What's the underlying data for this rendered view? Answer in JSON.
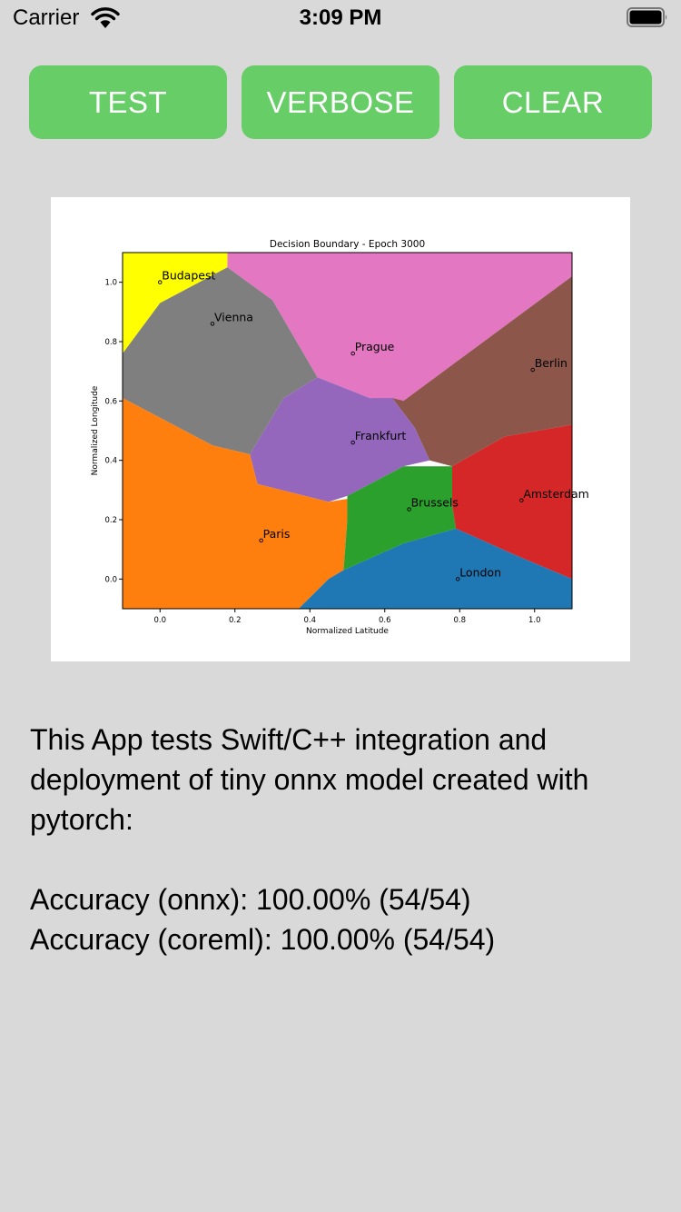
{
  "status_bar": {
    "carrier": "Carrier",
    "time": "3:09 PM",
    "wifi_icon": "wifi-icon",
    "battery_icon": "battery-icon"
  },
  "buttons": {
    "test": "TEST",
    "verbose": "VERBOSE",
    "clear": "CLEAR",
    "color": "#66cd67"
  },
  "chart_data": {
    "type": "scatter",
    "title": "Decision Boundary - Epoch 3000",
    "xlabel": "Normalized Latitude",
    "ylabel": "Normalized Longitude",
    "xlim": [
      -0.1,
      1.1
    ],
    "ylim": [
      -0.1,
      1.1
    ],
    "xticks": [
      0.0,
      0.2,
      0.4,
      0.6,
      0.8,
      1.0
    ],
    "yticks": [
      0.0,
      0.2,
      0.4,
      0.6,
      0.8,
      1.0
    ],
    "tick_labels_x": [
      "0.0",
      "0.2",
      "0.4",
      "0.6",
      "0.8",
      "1.0"
    ],
    "tick_labels_y": [
      "0.0",
      "0.2",
      "0.4",
      "0.6",
      "0.8",
      "1.0"
    ],
    "points": [
      {
        "label": "Budapest",
        "x": 0.0,
        "y": 1.0,
        "color": "#ffff00"
      },
      {
        "label": "Vienna",
        "x": 0.14,
        "y": 0.86,
        "color": "#7f7f7f"
      },
      {
        "label": "Prague",
        "x": 0.515,
        "y": 0.76,
        "color": "#e377c2"
      },
      {
        "label": "Berlin",
        "x": 0.995,
        "y": 0.705,
        "color": "#8c564b"
      },
      {
        "label": "Frankfurt",
        "x": 0.515,
        "y": 0.46,
        "color": "#9467bd"
      },
      {
        "label": "Brussels",
        "x": 0.665,
        "y": 0.235,
        "color": "#2ca02c"
      },
      {
        "label": "Amsterdam",
        "x": 0.965,
        "y": 0.265,
        "color": "#d62728"
      },
      {
        "label": "Paris",
        "x": 0.27,
        "y": 0.13,
        "color": "#ff7f0e"
      },
      {
        "label": "London",
        "x": 0.795,
        "y": 0.0,
        "color": "#1f77b4"
      }
    ],
    "regions": [
      {
        "label": "Budapest",
        "color": "#ffff00",
        "polygon": [
          [
            -0.1,
            1.1
          ],
          [
            0.18,
            1.1
          ],
          [
            0.18,
            1.05
          ],
          [
            0.0,
            0.93
          ],
          [
            -0.1,
            0.76
          ]
        ]
      },
      {
        "label": "Prague",
        "color": "#e377c2",
        "polygon": [
          [
            0.18,
            1.1
          ],
          [
            1.1,
            1.1
          ],
          [
            1.1,
            1.02
          ],
          [
            0.65,
            0.6
          ],
          [
            0.56,
            0.61
          ],
          [
            0.42,
            0.68
          ],
          [
            0.3,
            0.94
          ],
          [
            0.18,
            1.05
          ]
        ]
      },
      {
        "label": "Vienna",
        "color": "#7f7f7f",
        "polygon": [
          [
            0.0,
            0.93
          ],
          [
            0.18,
            1.05
          ],
          [
            0.3,
            0.94
          ],
          [
            0.42,
            0.68
          ],
          [
            0.33,
            0.61
          ],
          [
            0.24,
            0.42
          ],
          [
            0.14,
            0.45
          ],
          [
            -0.1,
            0.61
          ],
          [
            -0.1,
            0.76
          ]
        ]
      },
      {
        "label": "Berlin",
        "color": "#8c564b",
        "polygon": [
          [
            0.65,
            0.6
          ],
          [
            1.1,
            1.02
          ],
          [
            1.1,
            0.52
          ],
          [
            0.92,
            0.48
          ],
          [
            0.78,
            0.38
          ],
          [
            0.72,
            0.4
          ],
          [
            0.68,
            0.51
          ],
          [
            0.62,
            0.61
          ]
        ]
      },
      {
        "label": "Frankfurt",
        "color": "#9467bd",
        "polygon": [
          [
            0.42,
            0.68
          ],
          [
            0.56,
            0.61
          ],
          [
            0.62,
            0.61
          ],
          [
            0.68,
            0.51
          ],
          [
            0.72,
            0.4
          ],
          [
            0.65,
            0.38
          ],
          [
            0.5,
            0.28
          ],
          [
            0.45,
            0.26
          ],
          [
            0.26,
            0.32
          ],
          [
            0.24,
            0.42
          ],
          [
            0.33,
            0.61
          ]
        ]
      },
      {
        "label": "Paris",
        "color": "#ff7f0e",
        "polygon": [
          [
            -0.1,
            0.61
          ],
          [
            0.14,
            0.45
          ],
          [
            0.24,
            0.42
          ],
          [
            0.26,
            0.32
          ],
          [
            0.45,
            0.26
          ],
          [
            0.5,
            0.27
          ],
          [
            0.5,
            0.2
          ],
          [
            0.49,
            0.03
          ],
          [
            0.45,
            0.0
          ],
          [
            0.37,
            -0.1
          ],
          [
            -0.1,
            -0.1
          ]
        ]
      },
      {
        "label": "Brussels",
        "color": "#2ca02c",
        "polygon": [
          [
            0.5,
            0.28
          ],
          [
            0.65,
            0.38
          ],
          [
            0.78,
            0.38
          ],
          [
            0.78,
            0.25
          ],
          [
            0.79,
            0.17
          ],
          [
            0.65,
            0.12
          ],
          [
            0.49,
            0.03
          ],
          [
            0.5,
            0.2
          ]
        ]
      },
      {
        "label": "Amsterdam",
        "color": "#d62728",
        "polygon": [
          [
            0.78,
            0.38
          ],
          [
            0.92,
            0.48
          ],
          [
            1.1,
            0.52
          ],
          [
            1.1,
            0.0
          ],
          [
            0.95,
            0.08
          ],
          [
            0.79,
            0.17
          ],
          [
            0.78,
            0.25
          ]
        ]
      },
      {
        "label": "London",
        "color": "#1f77b4",
        "polygon": [
          [
            0.37,
            -0.1
          ],
          [
            0.45,
            0.0
          ],
          [
            0.49,
            0.03
          ],
          [
            0.65,
            0.12
          ],
          [
            0.79,
            0.17
          ],
          [
            0.95,
            0.08
          ],
          [
            1.1,
            0.0
          ],
          [
            1.1,
            -0.1
          ]
        ]
      }
    ]
  },
  "description": {
    "line1": "This App tests Swift/C++ integration and",
    "line2": "deployment of tiny onnx model created with",
    "line3": "pytorch:",
    "accuracy_onnx": "Accuracy (onnx): 100.00% (54/54)",
    "accuracy_coreml": "Accuracy (coreml): 100.00% (54/54)"
  }
}
